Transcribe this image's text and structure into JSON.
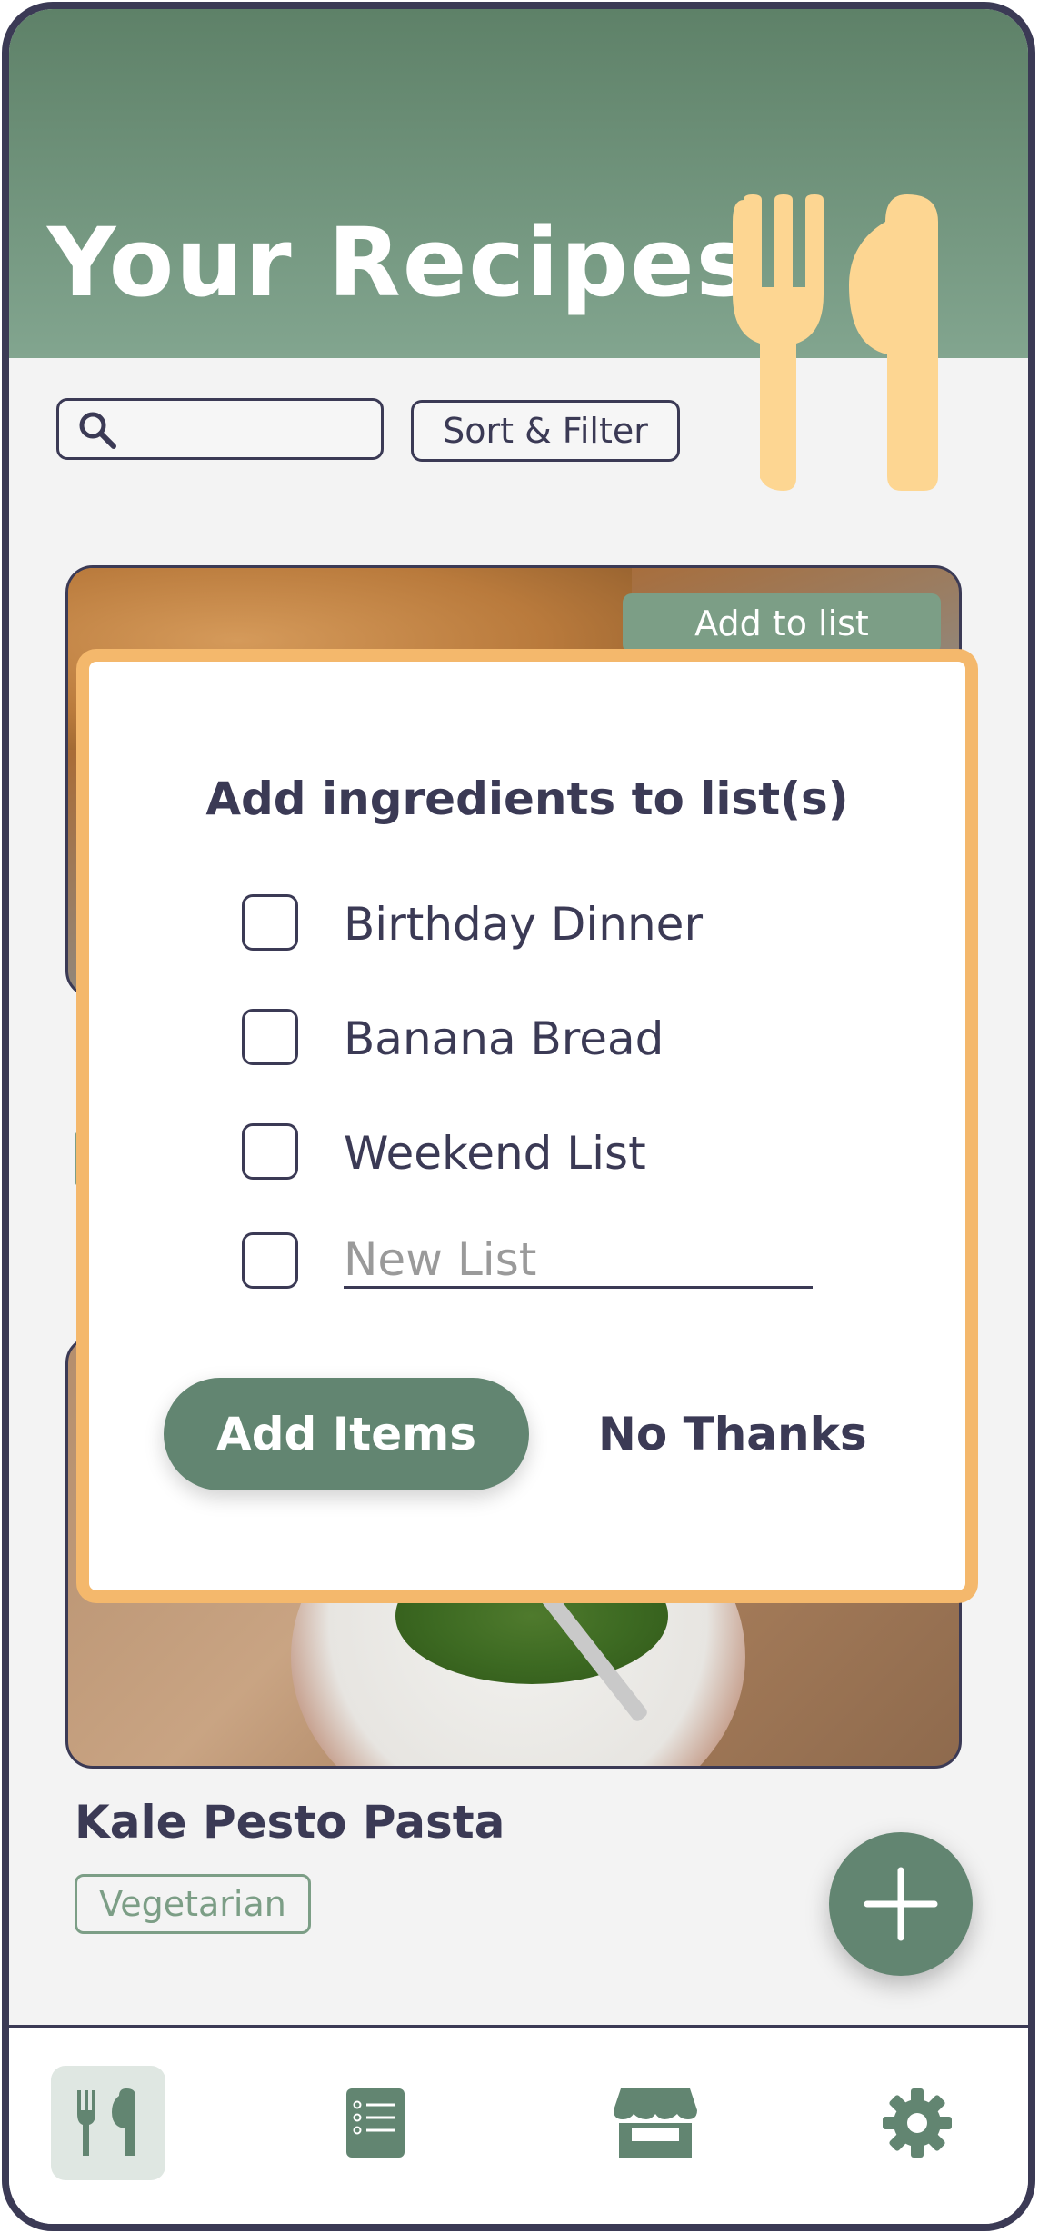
{
  "header": {
    "title": "Your Recipes"
  },
  "search": {
    "placeholder": "",
    "icon": "search-icon"
  },
  "toolbar": {
    "sort_filter_label": "Sort & Filter"
  },
  "cards": [
    {
      "add_to_list_label": "Add to list"
    },
    {
      "name": "Kale Pesto Pasta",
      "tag": "Vegetarian"
    }
  ],
  "modal": {
    "title": "Add ingredients to list(s)",
    "options": [
      {
        "label": "Birthday Dinner"
      },
      {
        "label": "Banana Bread"
      },
      {
        "label": "Weekend List"
      }
    ],
    "new_list_placeholder": "New List",
    "add_button": "Add Items",
    "cancel_button": "No Thanks"
  },
  "nav": {
    "items": [
      {
        "icon": "fork-knife-icon",
        "active": true
      },
      {
        "icon": "list-icon",
        "active": false
      },
      {
        "icon": "store-icon",
        "active": false
      },
      {
        "icon": "gear-icon",
        "active": false
      }
    ]
  },
  "colors": {
    "header_top": "#5e8168",
    "header_bottom": "#82a58f",
    "accent_green": "#628571",
    "modal_border": "#f4b86c",
    "utensils": "#fdd692",
    "text_dark": "#3b3a55"
  }
}
